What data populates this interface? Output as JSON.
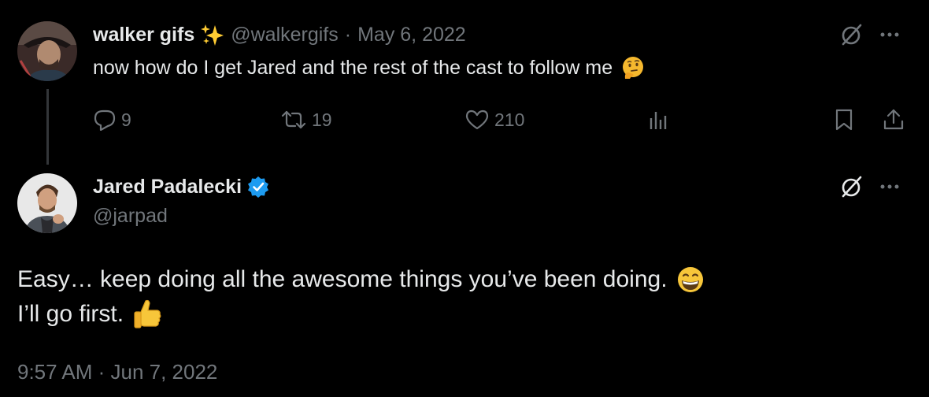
{
  "tweet1": {
    "display_name": "walker gifs",
    "sparkle_emoji": "sparkles-emoji",
    "handle": "@walkergifs",
    "separator": "·",
    "date": "May 6, 2022",
    "text": "now how do I get Jared and the rest of the cast to follow me",
    "text_emoji": "thinking-face-emoji",
    "actions": {
      "replies": "9",
      "retweets": "19",
      "likes": "210"
    }
  },
  "tweet2": {
    "display_name": "Jared Padalecki",
    "verified": true,
    "handle": "@jarpad",
    "line1": "Easy… keep doing all the awesome things you’ve been doing.",
    "line1_emoji": "grinning-face-emoji",
    "line2": "I’ll go first.",
    "line2_emoji": "thumbs-up-emoji",
    "timestamp": "9:57 AM · Jun 7, 2022"
  },
  "colors": {
    "background": "#000000",
    "text": "#e7e9ea",
    "muted": "#71767b",
    "verified": "#1d9bf0",
    "thread_line": "#333639"
  }
}
